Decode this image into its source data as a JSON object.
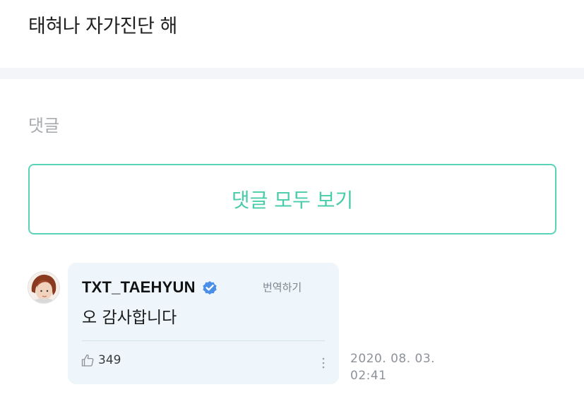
{
  "post": {
    "body_text": "태혀나 자가진단 해"
  },
  "comments_section": {
    "label": "댓글",
    "view_all_label": "댓글 모두 보기",
    "accent_color": "#48cca9"
  },
  "comment": {
    "author": "TXT_TAEHYUN",
    "verified": true,
    "verified_icon": "verified-badge-icon",
    "translate_label": "번역하기",
    "text": "오 감사합니다",
    "like_icon": "thumbs-up-icon",
    "like_count": "349",
    "more_icon": "vertical-dots-icon",
    "timestamp_date": "2020. 08. 03.",
    "timestamp_time": "02:41",
    "bubble_color": "#eef6fb"
  }
}
